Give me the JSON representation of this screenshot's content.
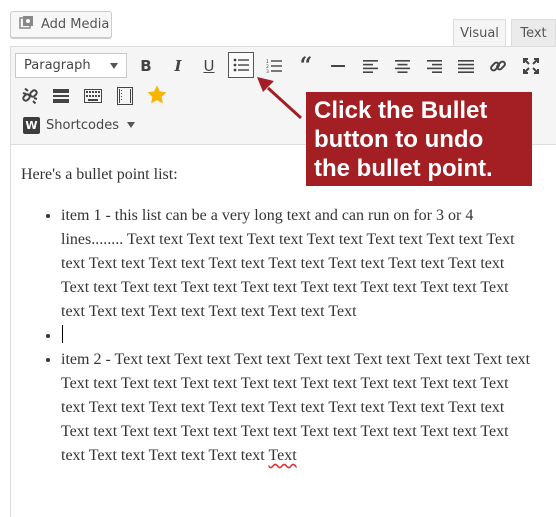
{
  "media": {
    "add_media_label": "Add Media"
  },
  "tabs": {
    "visual": "Visual",
    "text": "Text"
  },
  "toolbar": {
    "format_value": "Paragraph",
    "shortcodes_label": "Shortcodes",
    "icons": [
      "bold-icon",
      "italic-icon",
      "underline-icon",
      "bulleted-list-icon",
      "numbered-list-icon",
      "blockquote-icon",
      "horizontal-line-icon",
      "align-left-icon",
      "align-center-icon",
      "align-right-icon",
      "justify-icon",
      "link-icon",
      "fullscreen-icon",
      "unlink-icon",
      "read-more-icon",
      "keyboard-icon",
      "toolbar-toggle-icon",
      "star-icon"
    ]
  },
  "callout": {
    "text": "Click the Bullet button to undo the bullet point."
  },
  "editor": {
    "intro": "Here's a bullet point list:",
    "items": [
      "item 1 - this list can be a very long text and can run on for 3 or 4 lines........ Text text Text text Text text Text text Text text Text text Text text Text text Text text Text text Text text Text text Text text Text text Text text Text text Text text Text text Text text Text text Text text Text text Text text Text text Text text Text text Text",
      "",
      "item 2  - Text text Text text Text text Text text Text text Text text Text text Text text Text text Text text Text text Text text Text text Text text Text text Text text Text text Text text Text text Text text Text text Text text Text text Text text Text text Text text Text text Text text Text text Text text Text text Text text Text text"
    ],
    "last_word": "Text"
  },
  "colors": {
    "callout_bg": "#a31f23",
    "star": "#f6b500",
    "active_border": "#555555"
  }
}
